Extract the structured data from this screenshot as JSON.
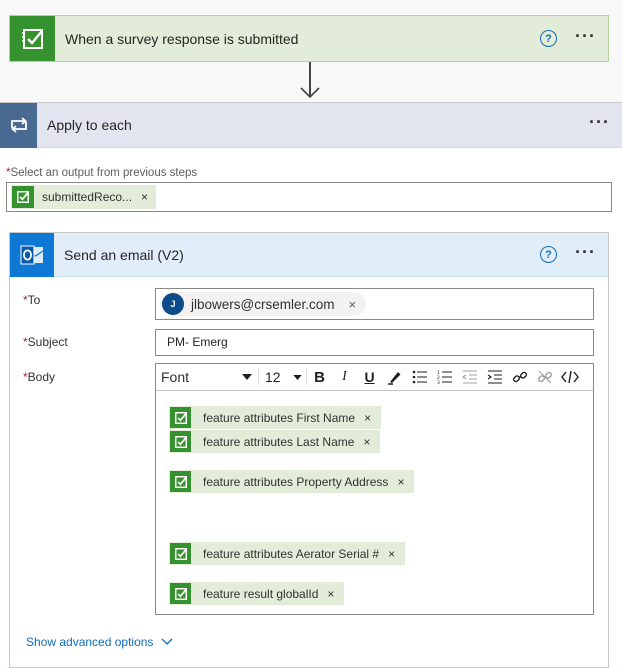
{
  "trigger": {
    "title": "When a survey response is submitted",
    "icon": "survey-check-icon",
    "help": "?",
    "more": "···"
  },
  "apply_each": {
    "title": "Apply to each",
    "icon": "loop-icon",
    "more": "···",
    "select_label": "Select an output from previous steps",
    "required_mark": "*",
    "token_label": "submittedReco...",
    "token_remove": "×"
  },
  "send_email": {
    "title": "Send an email (V2)",
    "icon": "outlook-icon",
    "help": "?",
    "more": "···",
    "to": {
      "label": "To",
      "avatar_initial": "J",
      "email": "jlbowers@crsemler.com",
      "remove": "×"
    },
    "subject": {
      "label": "Subject",
      "value": "PM- Emerg"
    },
    "body": {
      "label": "Body",
      "toolbar": {
        "font": "Font",
        "size": "12",
        "bold": "B",
        "italic": "I",
        "underline": "U"
      },
      "tokens": [
        {
          "label": "feature attributes First Name",
          "remove": "×"
        },
        {
          "label": "feature attributes Last Name",
          "remove": "×"
        },
        {
          "label": "feature attributes Property Address",
          "remove": "×"
        },
        {
          "label": "feature attributes Aerator Serial #",
          "remove": "×"
        },
        {
          "label": "feature result globalId",
          "remove": "×"
        }
      ]
    },
    "advanced_label": "Show advanced options"
  },
  "colors": {
    "survey_green": "#35922e",
    "loop_blue": "#486991",
    "outlook_blue": "#0f78d4",
    "link": "#0f6cbd",
    "required": "#a4262c"
  }
}
